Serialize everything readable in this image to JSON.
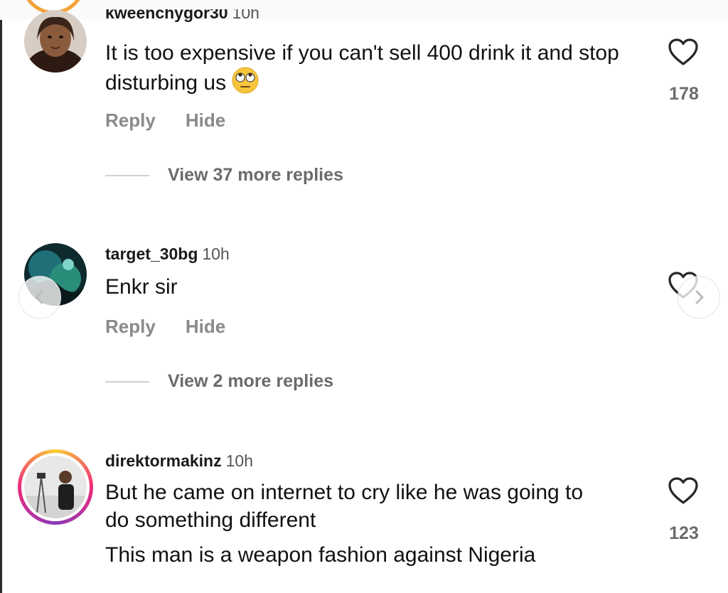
{
  "comments": [
    {
      "username": "kweenchygor30",
      "time": "10h",
      "text": "It is too expensive if you can't sell 400 drink it and stop disturbing us",
      "emoji": "eye-roll-emoji",
      "likes": "178",
      "reply_label": "Reply",
      "hide_label": "Hide",
      "view_more": "View 37 more replies"
    },
    {
      "username": "target_30bg",
      "time": "10h",
      "text": "Enkr sir",
      "reply_label": "Reply",
      "hide_label": "Hide",
      "view_more": "View 2 more replies"
    },
    {
      "username": "direktormakinz",
      "time": "10h",
      "text": "But he came on internet to cry like he was going to do something different",
      "text2": "This man is a weapon fashion against Nigeria",
      "likes": "123"
    }
  ],
  "icons": {
    "heart": "heart-icon",
    "prev": "chevron-left-icon",
    "next": "chevron-right-icon"
  },
  "colors": {
    "story_ring_gradient": [
      "#f9ce34",
      "#ee2a7b",
      "#8a3ab9"
    ],
    "top_ring": "#f4a236"
  }
}
